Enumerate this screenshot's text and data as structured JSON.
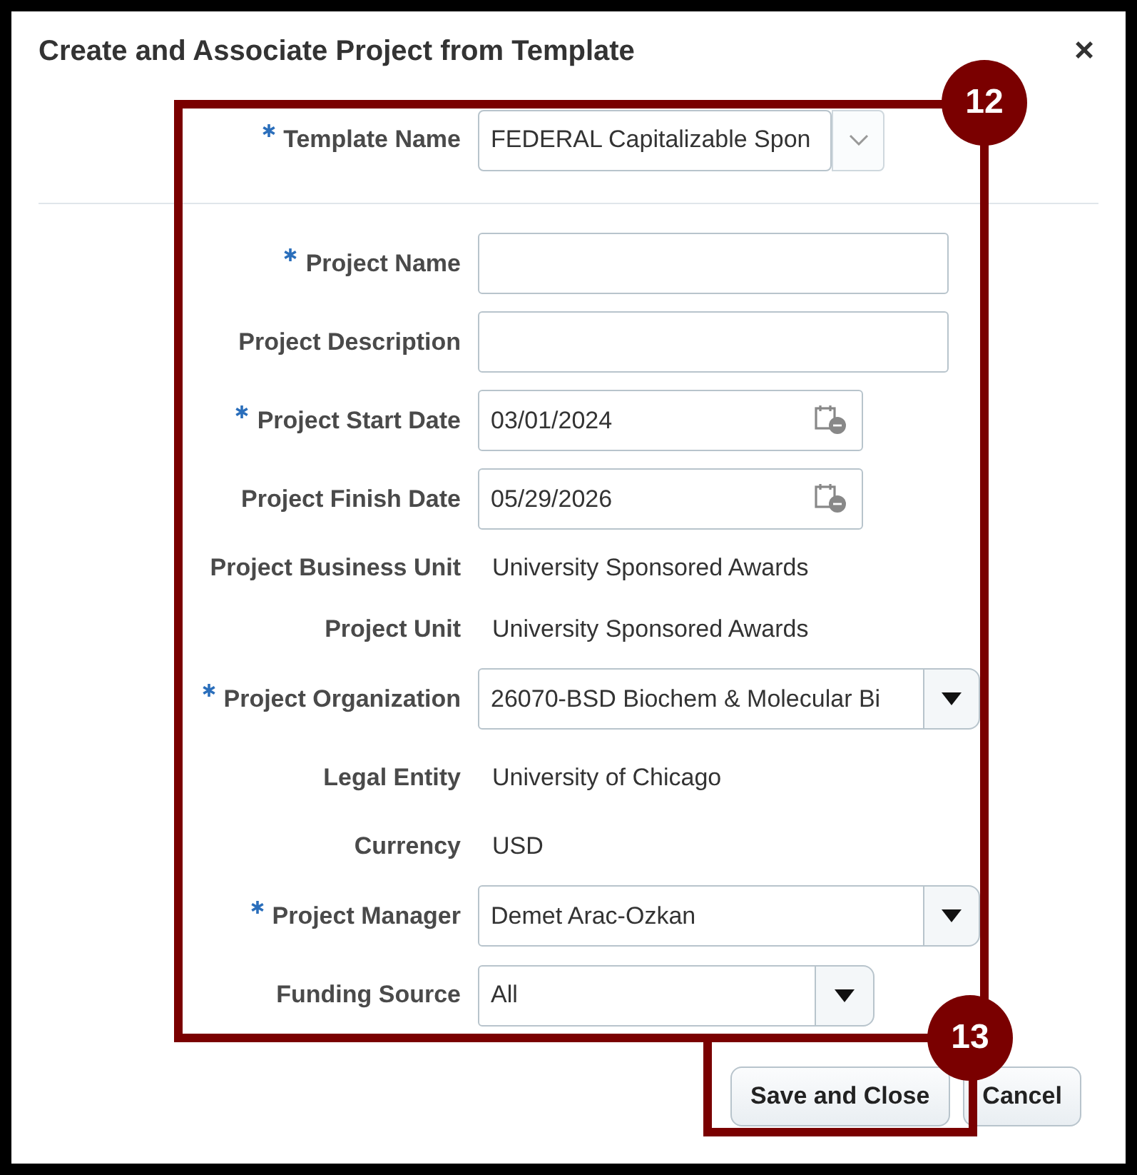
{
  "dialog": {
    "title": "Create and Associate Project from Template",
    "close": "×"
  },
  "template": {
    "label": "Template Name",
    "required": true,
    "value": "FEDERAL Capitalizable Spon"
  },
  "fields": [
    {
      "kind": "text",
      "label": "Project Name",
      "required": true
    },
    {
      "kind": "text",
      "label": "Project Description",
      "required": false
    },
    {
      "kind": "date",
      "label": "Project Start Date",
      "required": true,
      "value": "03/01/2024"
    },
    {
      "kind": "date",
      "label": "Project Finish Date",
      "required": false,
      "value": "05/29/2026"
    },
    {
      "kind": "readonly",
      "label": "Project Business Unit",
      "required": false,
      "value": "University Sponsored Awards"
    },
    {
      "kind": "readonly",
      "label": "Project Unit",
      "required": false,
      "value": "University Sponsored Awards"
    },
    {
      "kind": "choice",
      "label": "Project Organization",
      "required": true,
      "value": "26070-BSD Biochem & Molecular Bi"
    },
    {
      "kind": "readonly",
      "label": "Legal Entity",
      "required": false,
      "value": "University of Chicago"
    },
    {
      "kind": "readonly",
      "label": "Currency",
      "required": false,
      "value": "USD"
    },
    {
      "kind": "choice",
      "label": "Project Manager",
      "required": true,
      "value": "Demet Arac-Ozkan"
    },
    {
      "kind": "choice_short",
      "label": "Funding Source",
      "required": false,
      "value": "All"
    }
  ],
  "buttons": [
    {
      "label": "Save and Close"
    },
    {
      "label": "Cancel"
    }
  ],
  "callouts": [
    {
      "number": "12"
    },
    {
      "number": "13"
    }
  ]
}
